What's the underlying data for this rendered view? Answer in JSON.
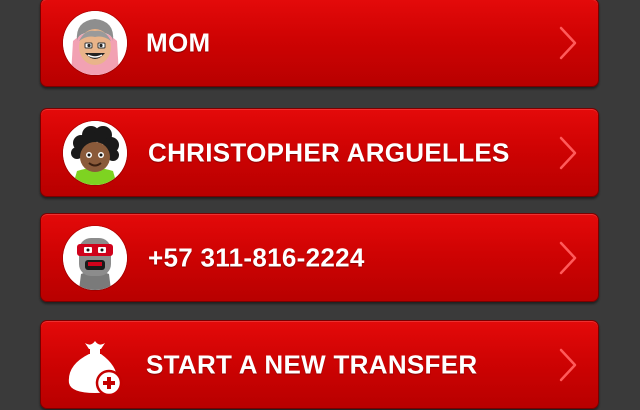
{
  "contacts": [
    {
      "name": "MOM",
      "avatar_icon": "grandmother-avatar-icon"
    },
    {
      "name": "CHRISTOPHER ARGUELLES",
      "avatar_icon": "curly-hair-avatar-icon"
    },
    {
      "name": "+57 311-816-2224",
      "avatar_icon": "masked-avatar-icon"
    }
  ],
  "new_transfer": {
    "label": "START A NEW TRANSFER",
    "icon": "money-bag-plus-icon"
  },
  "colors": {
    "background": "#3a3a3a",
    "row_top": "#e40a0a",
    "row_bottom": "#b80000",
    "text": "#ffffff",
    "chevron": "#ff5a5a"
  }
}
